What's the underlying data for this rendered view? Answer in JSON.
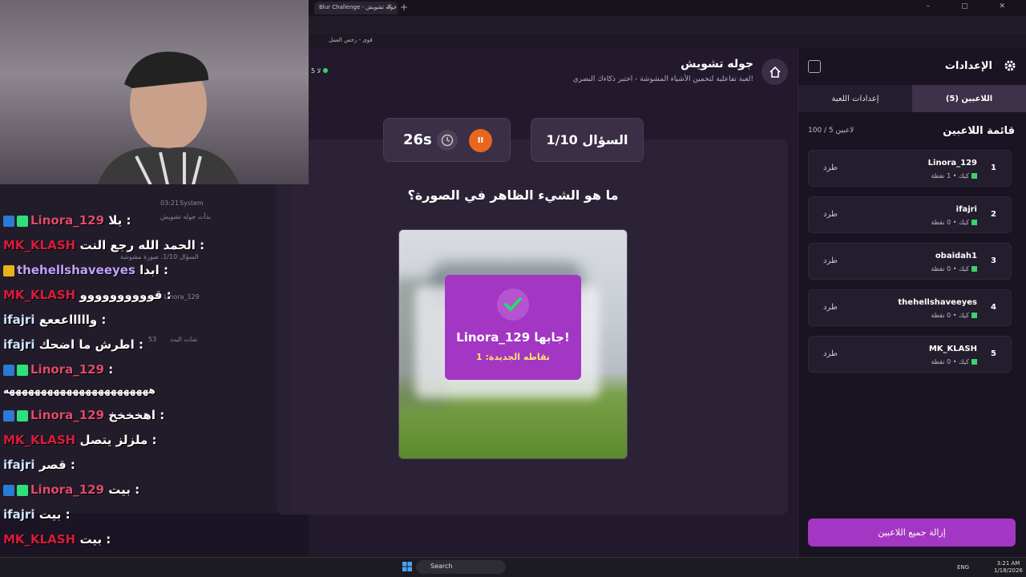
{
  "browser": {
    "tab_title": "Blur Challenge - جوله تشويش",
    "tab_close": "×",
    "new_tab": "+",
    "window_controls": "–  ▢  ✕",
    "bookmark": "قوى - رخص العمل"
  },
  "header": {
    "title": "جوله تشويش",
    "subtitle": "لعبة تفاعلية لتخمين الأشياء المشوشة - اختبر ذكاءك البصري!",
    "online_count": "5 لا"
  },
  "game": {
    "timer": "26s",
    "question_counter": "السؤال 1/10",
    "question": "ما هو الشيء الظاهر في الصورة؟",
    "winner_title": "Linora_129 جابها!",
    "winner_points": "نقاطه الجديدة: 1",
    "pause_icon": "II"
  },
  "settings": {
    "title": "الإعدادات",
    "tab_players": "اللاعبين (5)",
    "tab_game_settings": "إعدادات اللعبة",
    "list_title": "قائمة اللاعبين",
    "list_count": "100 / 5 لاعبين",
    "kick_label": "طرد",
    "players": [
      {
        "rank": "1",
        "name": "Linora_129",
        "info": "كيك • 1 نقطة"
      },
      {
        "rank": "2",
        "name": "ifajri",
        "info": "كيك • 0 نقطة"
      },
      {
        "rank": "3",
        "name": "obaidah1",
        "info": "كيك • 0 نقطة"
      },
      {
        "rank": "4",
        "name": "thehellshaveeyes",
        "info": "كيك • 0 نقطة"
      },
      {
        "rank": "5",
        "name": "MK_KLASH",
        "info": "كيك • 0 نقطة"
      }
    ],
    "clear_button": "إزالة جميع اللاعبين"
  },
  "chat": {
    "messages": [
      {
        "user": "Linora_129",
        "text": "يلا :",
        "color": "#e04b6a"
      },
      {
        "user": "MK_KLASH",
        "text": "الحمد الله رجع النت :",
        "color": "#d81b3b"
      },
      {
        "user": "thehellshaveeyes",
        "text": "ابدا :",
        "color": "#c0a2ff"
      },
      {
        "user": "MK_KLASH",
        "text": "قوووووووووو :",
        "color": "#d81b3b"
      },
      {
        "user": "ifajri",
        "text": "واااااعععع :",
        "color": "#cfe6ff"
      },
      {
        "user": "ifajri",
        "text": "اطرش ما اضحك :",
        "color": "#cfe6ff"
      },
      {
        "user": "Linora_129",
        "text": ":",
        "color": "#e04b6a"
      },
      {
        "user": "",
        "text": "هههههههههههههههههههههههه",
        "color": "#ffffff"
      },
      {
        "user": "Linora_129",
        "text": "اهخخخخ :",
        "color": "#e04b6a"
      },
      {
        "user": "MK_KLASH",
        "text": "ملزلز يتصل :",
        "color": "#d81b3b"
      },
      {
        "user": "ifajri",
        "text": "قصر :",
        "color": "#cfe6ff"
      },
      {
        "user": "Linora_129",
        "text": "بيت :",
        "color": "#e04b6a"
      },
      {
        "user": "ifajri",
        "text": "بيت :",
        "color": "#cfe6ff"
      },
      {
        "user": "MK_KLASH",
        "text": "بيت :",
        "color": "#d81b3b"
      }
    ],
    "system_label": "System",
    "system_time": "03:21",
    "system_msg_1": "بدأت جوله تشويش",
    "system_msg_2": "السؤال 1/10، صورة مشوشة",
    "system_msg_3": "اللاعب Linora_129",
    "stream_chat_label": "شات البث",
    "stream_chat_count": "53"
  },
  "taskbar": {
    "search": "Search",
    "lang": "ENG",
    "time": "3:21 AM",
    "date": "1/18/2026"
  }
}
